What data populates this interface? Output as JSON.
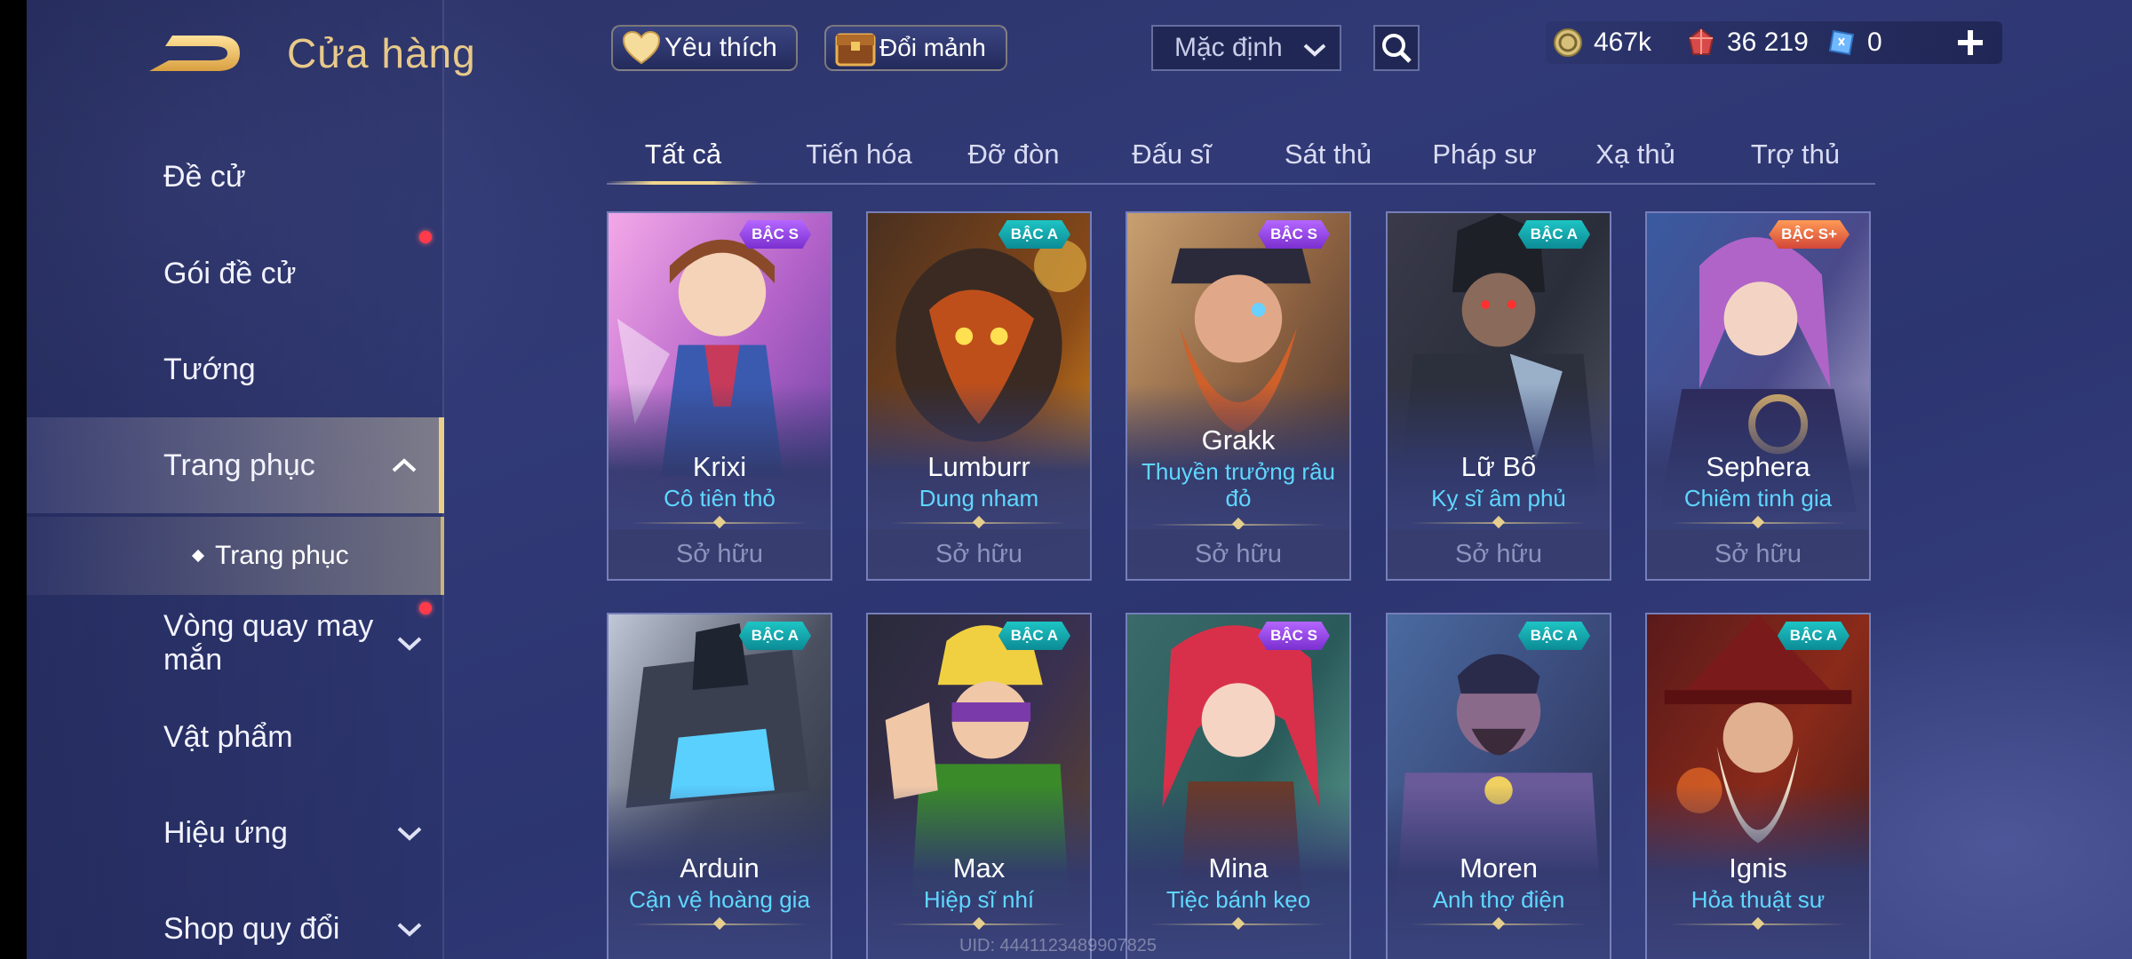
{
  "header": {
    "title": "Cửa hàng"
  },
  "topbar": {
    "favorite_label": "Yêu thích",
    "exchange_label": "Đổi mảnh",
    "sort_value": "Mặc định"
  },
  "currency": {
    "gold": "467k",
    "ruby": "36 219",
    "vouchers": "0"
  },
  "sidebar": {
    "items": [
      {
        "label": "Đề cử"
      },
      {
        "label": "Gói đề cử"
      },
      {
        "label": "Tướng"
      },
      {
        "label": "Trang phục"
      },
      {
        "label": "Trang phục"
      },
      {
        "label": "Vòng quay may mắn"
      },
      {
        "label": "Vật phẩm"
      },
      {
        "label": "Hiệu ứng"
      },
      {
        "label": "Shop quy đổi"
      }
    ]
  },
  "tabs": [
    "Tất cả",
    "Tiến hóa",
    "Đỡ đòn",
    "Đấu sĩ",
    "Sát thủ",
    "Pháp sư",
    "Xạ thủ",
    "Trợ thủ"
  ],
  "cards": [
    {
      "rank": "BẬC S",
      "hero": "Krixi",
      "skin": "Cô tiên thỏ",
      "status": "Sở hữu"
    },
    {
      "rank": "BẬC A",
      "hero": "Lumburr",
      "skin": "Dung nham",
      "status": "Sở hữu"
    },
    {
      "rank": "BẬC S",
      "hero": "Grakk",
      "skin": "Thuyền trưởng râu đỏ",
      "status": "Sở hữu"
    },
    {
      "rank": "BẬC A",
      "hero": "Lữ Bố",
      "skin": "Kỵ sĩ âm phủ",
      "status": "Sở hữu"
    },
    {
      "rank": "BẬC S+",
      "hero": "Sephera",
      "skin": "Chiêm tinh gia",
      "status": "Sở hữu"
    },
    {
      "rank": "BẬC A",
      "hero": "Arduin",
      "skin": "Cận vệ hoàng gia",
      "status": ""
    },
    {
      "rank": "BẬC A",
      "hero": "Max",
      "skin": "Hiệp sĩ nhí",
      "status": ""
    },
    {
      "rank": "BẬC S",
      "hero": "Mina",
      "skin": "Tiệc bánh kẹo",
      "status": ""
    },
    {
      "rank": "BẬC A",
      "hero": "Moren",
      "skin": "Anh thợ điện",
      "status": ""
    },
    {
      "rank": "BẬC A",
      "hero": "Ignis",
      "skin": "Hỏa thuật sư",
      "status": ""
    }
  ],
  "footer": {
    "uid": "UID: 4441123489907825"
  },
  "colors": {
    "accent_gold": "#e8c98a",
    "skin_name": "#5fd7ff",
    "badge_s": "#9b4ae8",
    "badge_a": "#15a8ae",
    "badge_sp": "#e56a48"
  }
}
